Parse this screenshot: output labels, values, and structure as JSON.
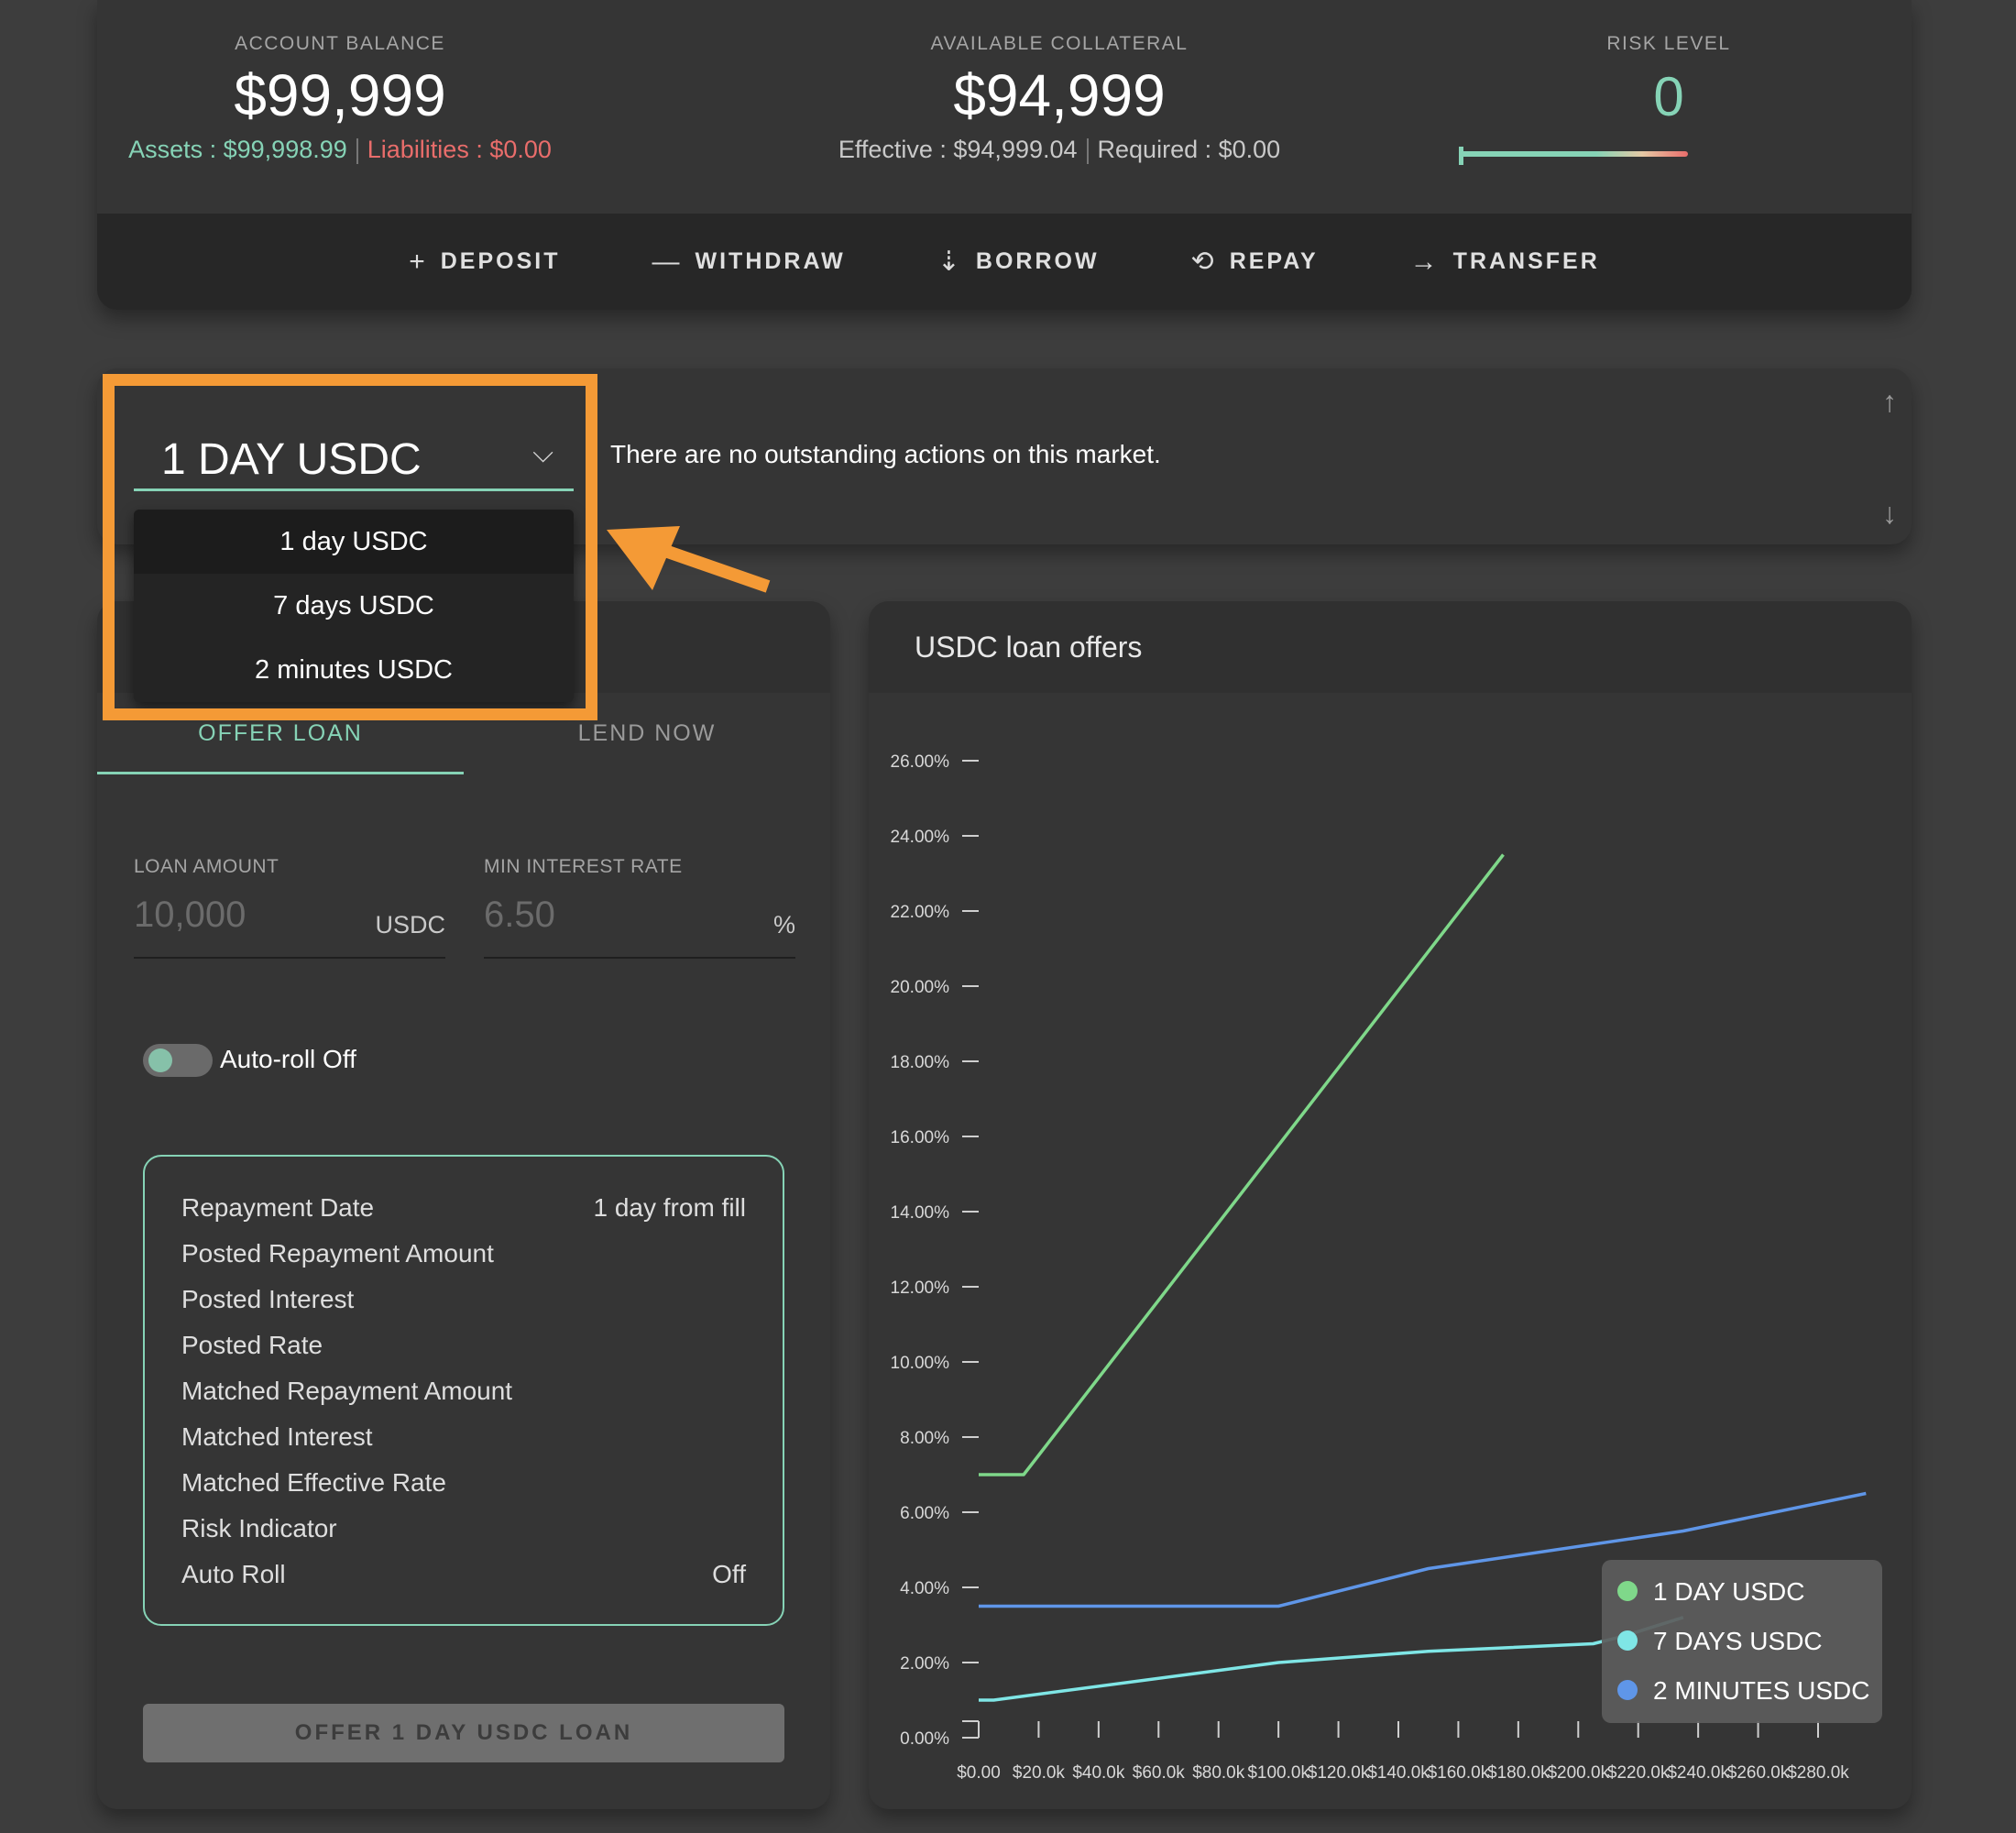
{
  "account": {
    "balance_label": "ACCOUNT BALANCE",
    "balance_value": "$99,999",
    "assets": "Assets : $99,998.99",
    "liabilities": "Liabilities : $0.00",
    "collateral_label": "AVAILABLE COLLATERAL",
    "collateral_value": "$94,999",
    "effective": "Effective : $94,999.04",
    "required": "Required : $0.00",
    "risk_label": "RISK LEVEL",
    "risk_value": "0"
  },
  "actions": {
    "deposit": {
      "icon": "+",
      "label": "DEPOSIT"
    },
    "withdraw": {
      "icon": "—",
      "label": "WITHDRAW"
    },
    "borrow": {
      "icon": "⇣",
      "label": "BORROW"
    },
    "repay": {
      "icon": "⟲",
      "label": "REPAY"
    },
    "transfer": {
      "icon": "→",
      "label": "TRANSFER"
    }
  },
  "market": {
    "selected": "1 DAY USDC",
    "chevron_icon": "chevron-down-icon",
    "message": "There are no outstanding actions on this market.",
    "scroll_up_icon": "↑",
    "scroll_down_icon": "↓",
    "options": [
      "1 day USDC",
      "7 days USDC",
      "2 minutes USDC"
    ]
  },
  "lend": {
    "header_title": "1 day USDC",
    "tabs": [
      "OFFER LOAN",
      "LEND NOW"
    ],
    "loan_amount_label": "LOAN AMOUNT",
    "loan_amount_placeholder": "10,000",
    "loan_amount_unit": "USDC",
    "min_rate_label": "MIN INTEREST RATE",
    "min_rate_placeholder": "6.50",
    "min_rate_unit": "%",
    "autoroll_label": "Auto-roll Off",
    "summary": [
      {
        "k": "Repayment Date",
        "v": "1 day from fill"
      },
      {
        "k": "Posted Repayment Amount",
        "v": ""
      },
      {
        "k": "Posted Interest",
        "v": ""
      },
      {
        "k": "Posted Rate",
        "v": ""
      },
      {
        "k": "Matched Repayment Amount",
        "v": ""
      },
      {
        "k": "Matched Interest",
        "v": ""
      },
      {
        "k": "Matched Effective Rate",
        "v": ""
      },
      {
        "k": "Risk Indicator",
        "v": ""
      },
      {
        "k": "Auto Roll",
        "v": "Off"
      }
    ],
    "offer_button": "OFFER 1 DAY USDC LOAN"
  },
  "colors": {
    "accent": "#86d3b6",
    "liability": "#e96d6b",
    "highlight": "#f49a36",
    "series_1day": "#7fd88a",
    "series_7days": "#7fe6e6",
    "series_2min": "#5f96e8"
  },
  "chart_data": {
    "type": "line",
    "title": "USDC loan offers",
    "y_ticks": [
      "0.00%",
      "2.00%",
      "4.00%",
      "6.00%",
      "8.00%",
      "10.00%",
      "12.00%",
      "14.00%",
      "16.00%",
      "18.00%",
      "20.00%",
      "22.00%",
      "24.00%",
      "26.00%"
    ],
    "x_ticks": [
      "$0.00",
      "$20.0k",
      "$40.0k",
      "$60.0k",
      "$80.0k",
      "$100.0k",
      "$120.0k",
      "$140.0k",
      "$160.0k",
      "$180.0k",
      "$200.0k",
      "$220.0k",
      "$240.0k",
      "$260.0k",
      "$280.0k"
    ],
    "ylim": [
      0,
      26
    ],
    "xlim": [
      0,
      280000
    ],
    "legend_position": "bottom-right",
    "series": [
      {
        "name": "1 DAY USDC",
        "color": "#7fd88a",
        "points": [
          [
            0,
            7.0
          ],
          [
            15000,
            7.0
          ],
          [
            175000,
            23.5
          ]
        ]
      },
      {
        "name": "7 DAYS USDC",
        "color": "#7fe6e6",
        "points": [
          [
            0,
            1.0
          ],
          [
            5000,
            1.0
          ],
          [
            100000,
            2.0
          ],
          [
            150000,
            2.3
          ],
          [
            205000,
            2.5
          ],
          [
            215000,
            2.7
          ],
          [
            235000,
            3.2
          ]
        ]
      },
      {
        "name": "2 MINUTES USDC",
        "color": "#5f96e8",
        "points": [
          [
            0,
            3.5
          ],
          [
            100000,
            3.5
          ],
          [
            150000,
            4.5
          ],
          [
            235000,
            5.5
          ],
          [
            296000,
            6.5
          ]
        ]
      }
    ]
  }
}
